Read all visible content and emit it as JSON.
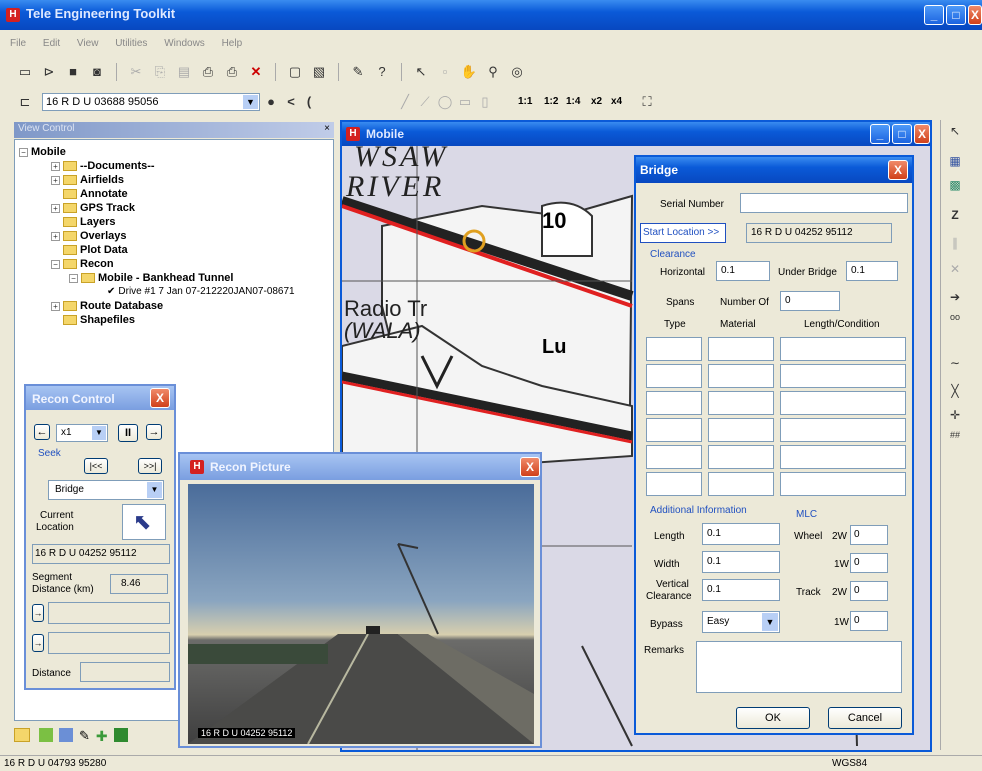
{
  "app": {
    "title": "Tele Engineering Toolkit",
    "menu": [
      "File",
      "Edit",
      "View",
      "Utilities",
      "Windows",
      "Help"
    ]
  },
  "location_combo": {
    "value": "16 R D U 03688 95056"
  },
  "toolbar_zoom": [
    "1:1",
    "1:2",
    "1:4",
    "x2",
    "x4"
  ],
  "tree": {
    "title": "View Control",
    "items": [
      "Mobile",
      "--Documents--",
      "Airfields",
      "Annotate",
      "GPS Track",
      "Layers",
      "Overlays",
      "Plot Data",
      "Recon",
      "Mobile - Bankhead Tunnel",
      "Drive #1 7 Jan 07-212220JAN07-08671",
      "Route Database",
      "Shapefiles"
    ]
  },
  "map_window": {
    "title": "Mobile",
    "labels": [
      "WSAW",
      "RIVER",
      "10",
      "Radio Tr",
      "(WALA)",
      "Lu"
    ]
  },
  "bridge": {
    "title": "Bridge",
    "serial_label": "Serial Number",
    "serial_value": "",
    "start_location_button": "Start Location >>",
    "start_location_value": "16 R D U 04252 95112",
    "clearance_label": "Clearance",
    "horizontal_label": "Horizontal",
    "horizontal_value": "0.1",
    "under_bridge_label": "Under Bridge",
    "under_bridge_value": "0.1",
    "spans_label": "Spans",
    "number_of_label": "Number Of",
    "number_of_value": "0",
    "col_type": "Type",
    "col_material": "Material",
    "col_length": "Length/Condition",
    "additional_label": "Additional Information",
    "length_label": "Length",
    "length_value": "0.1",
    "width_label": "Width",
    "width_value": "0.1",
    "vertical_label1": "Vertical",
    "vertical_label2": "Clearance",
    "vertical_value": "0.1",
    "bypass_label": "Bypass",
    "bypass_value": "Easy",
    "mlc_label": "MLC",
    "wheel_label": "Wheel",
    "track_label": "Track",
    "twow": "2W",
    "onew": "1W",
    "wheel_2w": "0",
    "wheel_1w": "0",
    "track_2w": "0",
    "track_1w": "0",
    "remarks_label": "Remarks",
    "ok": "OK",
    "cancel": "Cancel"
  },
  "recon_control": {
    "title": "Recon Control",
    "speed": "x1",
    "seek_label": "Seek",
    "seek_back": "|<<",
    "seek_fwd": ">>|",
    "type_value": "Bridge",
    "current_label1": "Current",
    "current_label2": "Location",
    "location_value": "16 R D U 04252 95112",
    "segment_label1": "Segment",
    "segment_label2": "Distance (km)",
    "segment_value": "8.46",
    "distance_label": "Distance"
  },
  "recon_picture": {
    "title": "Recon Picture",
    "caption": "16 R D U 04252 95112"
  },
  "status": {
    "left": "16 R D U 04793 95280",
    "right": "WGS84"
  },
  "colors": {
    "title_bar": "#0a5ad8",
    "road_red": "#e02020",
    "map_bg": "#dad9e6",
    "dialog_bg": "#ece9d8"
  }
}
